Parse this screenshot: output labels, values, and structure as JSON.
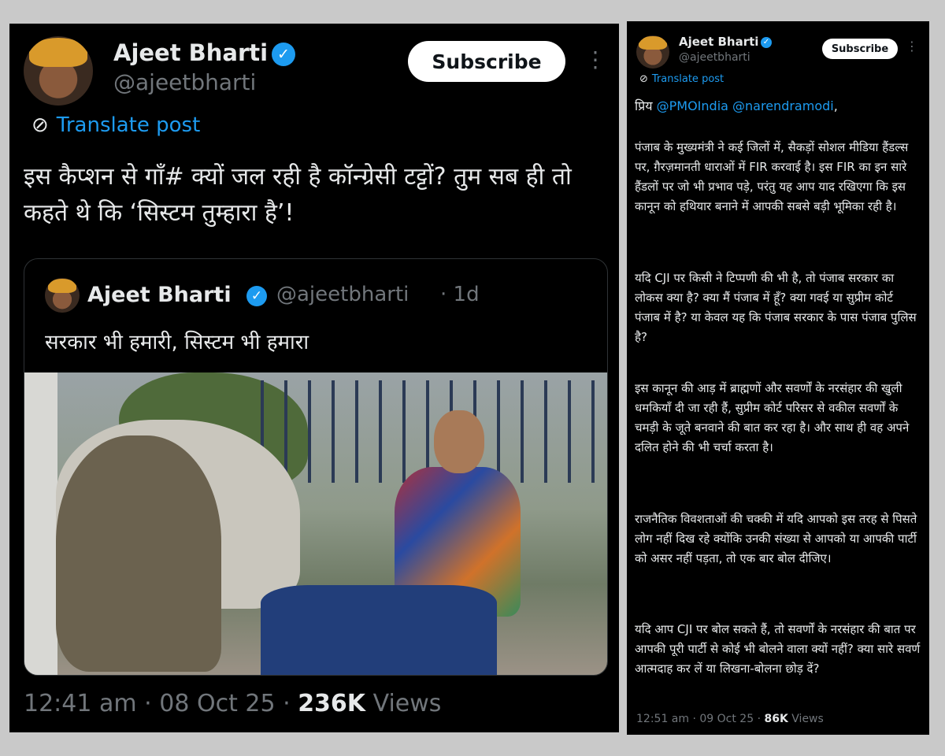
{
  "left_post": {
    "author_name": "Ajeet Bharti",
    "author_handle": "@ajeetbharti",
    "subscribe_label": "Subscribe",
    "translate_label": "Translate post",
    "text": "इस कैप्शन से गाँ# क्यों जल रही है कॉन्ग्रेसी टट्टों? तुम सब ही तो कहते थे कि ‘सिस्टम तुम्हारा है’!",
    "quote": {
      "author_name": "Ajeet Bharti",
      "author_handle": "@ajeetbharti",
      "time": "· 1d",
      "text": "सरकार भी हमारी, सिस्टम भी हमारा"
    },
    "time": "12:41 am",
    "date": "08 Oct 25",
    "views_count": "236K",
    "views_label": "Views"
  },
  "right_post": {
    "author_name": "Ajeet Bharti",
    "author_handle": "@ajeetbharti",
    "subscribe_label": "Subscribe",
    "translate_label": "Translate post",
    "greeting_prefix": "प्रिय",
    "mention_1": "@PMOIndia",
    "mention_2": "@narendramodi",
    "greeting_suffix": ",",
    "paragraphs": [
      "पंजाब के मुख्यमंत्री ने कई जिलों में, सैकड़ों सोशल मीडिया हैंडल्स पर, ग़ैरज़मानती धाराओं में FIR करवाई है। इस FIR का इन सारे हैंडलों पर जो भी प्रभाव पड़े, परंतु यह आप याद रखिएगा कि इस कानून को हथियार बनाने में आपकी सबसे बड़ी भूमिका रही है।",
      "यदि CJI पर किसी ने टिप्पणी की भी है, तो पंजाब सरकार का लोकस क्या है? क्या मैं पंजाब में हूँ? क्या गवई या सुप्रीम कोर्ट पंजाब में है? या केवल यह कि पंजाब सरकार के पास पंजाब पुलिस है?",
      "इस कानून की आड़ में ब्राह्मणों और सवर्णों के नरसंहार की खुली धमकियाँ दी जा रही हैं, सुप्रीम कोर्ट परिसर से वकील सवर्णों के चमड़ी के जूते बनवाने की बात कर रहा है। और साथ ही वह अपने दलित होने की भी चर्चा करता है।",
      "राजनैतिक विवशताओं की चक्की में यदि आपको इस तरह से पिसते लोग नहीं दिख रहे क्योंकि उनकी संख्या से आपको या आपकी पार्टी को असर नहीं पड़ता, तो एक बार बोल दीजिए।",
      "यदि आप CJI पर बोल सकते हैं, तो सवर्णों के नरसंहार की बात पर आपकी पूरी पार्टी से कोई भी बोलने वाला क्यों नहीं? क्या सारे सवर्ण आत्मदाह कर लें या लिखना-बोलना छोड़ दें?"
    ],
    "time": "12:51 am",
    "date": "09 Oct 25",
    "views_count": "86K",
    "views_label": "Views"
  },
  "icons": {
    "verified": "✓",
    "translate": "⊘",
    "kebab": "⋮",
    "separator": "·"
  },
  "colors": {
    "background": "#000000",
    "accent_blue": "#1d9bf0",
    "muted_text": "#71767b",
    "primary_text": "#e7e9ea"
  }
}
